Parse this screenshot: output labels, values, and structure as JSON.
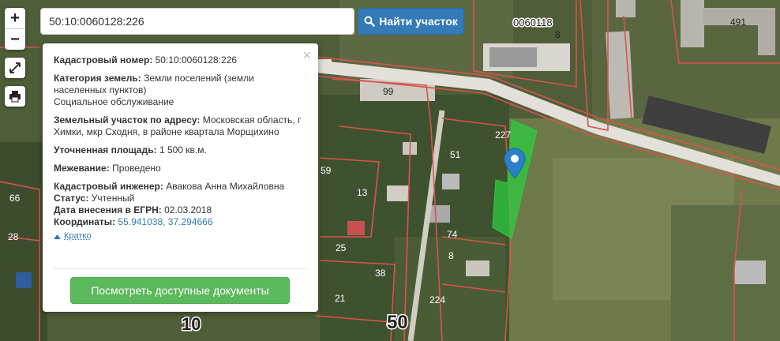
{
  "search": {
    "value": "50:10:0060128:226",
    "button_label": "Найти участок"
  },
  "map_controls": {
    "zoom_in": "+",
    "zoom_out": "−"
  },
  "popup": {
    "close": "×",
    "cadastral_number": {
      "label": "Кадастровый номер:",
      "value": "50:10:0060128:226"
    },
    "land_category": {
      "label": "Категория земель:",
      "value": "Земли поселений (земли населенных пунктов)",
      "use": "Социальное обслуживание"
    },
    "address": {
      "label": "Земельный участок по адресу:",
      "value": "Московская область, г Химки, мкр Сходня, в районе квартала Морщихино"
    },
    "area": {
      "label": "Уточненная площадь:",
      "value": "1 500 кв.м."
    },
    "survey": {
      "label": "Межевание:",
      "value": "Проведено"
    },
    "engineer": {
      "label": "Кадастровый инженер:",
      "value": "Авакова Анна Михайловна"
    },
    "status": {
      "label": "Статус:",
      "value": "Учтенный"
    },
    "egrn_date": {
      "label": "Дата внесения в ЕГРН:",
      "value": "02.03.2018"
    },
    "coordinates": {
      "label": "Координаты:",
      "value": "55.941038, 37.294666"
    },
    "brief_link": "Кратко",
    "documents_button": "Посмотреть доступные документы"
  },
  "map_labels": {
    "quarter": "0060118",
    "big_50": "50",
    "big_10": "10",
    "n227": "227",
    "n99": "99",
    "n59": "59",
    "n13": "13",
    "n74": "74",
    "n38": "38",
    "n224": "224",
    "n51": "51",
    "n8a": "8",
    "n8b": "8",
    "n491": "491",
    "n25": "25",
    "n21": "21",
    "n66": "66",
    "n28": "28"
  },
  "colors": {
    "parcel": "#2ecc40",
    "boundary": "#d9534f",
    "marker": "#2a81cb",
    "road": "#e2e0d8"
  }
}
